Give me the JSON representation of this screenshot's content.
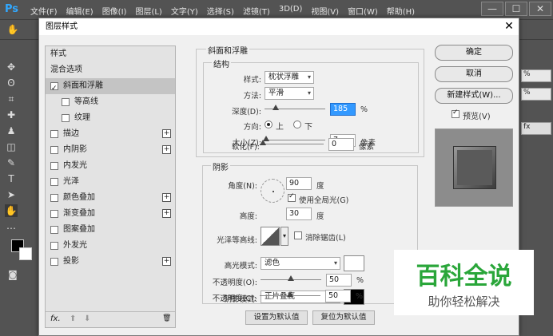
{
  "app": {
    "logo": "Ps",
    "menus": [
      "文件(F)",
      "编辑(E)",
      "图像(I)",
      "图层(L)",
      "文字(Y)",
      "选择(S)",
      "滤镜(T)",
      "3D(D)",
      "视图(V)",
      "窗口(W)",
      "帮助(H)"
    ],
    "window_controls": [
      "—",
      "☐",
      "✕"
    ]
  },
  "right_panel": {
    "items": [
      "%",
      "%",
      "fx"
    ]
  },
  "dialog": {
    "title": "图层样式",
    "close_glyph": "✕",
    "styles_list": {
      "header": "样式",
      "items": [
        {
          "label": "混合选项",
          "checkbox": false,
          "checked": false,
          "plus": false,
          "indent": false,
          "selected": false
        },
        {
          "label": "斜面和浮雕",
          "checkbox": true,
          "checked": true,
          "plus": false,
          "indent": false,
          "selected": true
        },
        {
          "label": "等高线",
          "checkbox": true,
          "checked": false,
          "plus": false,
          "indent": true,
          "selected": false
        },
        {
          "label": "纹理",
          "checkbox": true,
          "checked": false,
          "plus": false,
          "indent": true,
          "selected": false
        },
        {
          "label": "描边",
          "checkbox": true,
          "checked": false,
          "plus": true,
          "indent": false,
          "selected": false
        },
        {
          "label": "内阴影",
          "checkbox": true,
          "checked": false,
          "plus": true,
          "indent": false,
          "selected": false
        },
        {
          "label": "内发光",
          "checkbox": true,
          "checked": false,
          "plus": false,
          "indent": false,
          "selected": false
        },
        {
          "label": "光泽",
          "checkbox": true,
          "checked": false,
          "plus": false,
          "indent": false,
          "selected": false
        },
        {
          "label": "颜色叠加",
          "checkbox": true,
          "checked": false,
          "plus": true,
          "indent": false,
          "selected": false
        },
        {
          "label": "渐变叠加",
          "checkbox": true,
          "checked": false,
          "plus": true,
          "indent": false,
          "selected": false
        },
        {
          "label": "图案叠加",
          "checkbox": true,
          "checked": false,
          "plus": false,
          "indent": false,
          "selected": false
        },
        {
          "label": "外发光",
          "checkbox": true,
          "checked": false,
          "plus": false,
          "indent": false,
          "selected": false
        },
        {
          "label": "投影",
          "checkbox": true,
          "checked": false,
          "plus": true,
          "indent": false,
          "selected": false
        }
      ],
      "footer_fx": "fx.",
      "footer_up": "⬆",
      "footer_down": "⬇",
      "footer_trash": "🗑"
    },
    "bevel": {
      "section_title": "斜面和浮雕",
      "structure_title": "结构",
      "style_label": "样式:",
      "style_value": "枕状浮雕",
      "technique_label": "方法:",
      "technique_value": "平滑",
      "depth_label": "深度(D):",
      "depth_value": "185",
      "depth_unit": "%",
      "depth_level": 0.18,
      "direction_label": "方向:",
      "direction_up": "上",
      "direction_down": "下",
      "size_label": "大小(Z):",
      "size_value": "7",
      "size_unit": "像素",
      "size_level": 0.03,
      "soften_label": "软化(F):",
      "soften_value": "0",
      "soften_unit": "像素",
      "soften_level": 0.0
    },
    "shading": {
      "title": "阴影",
      "angle_label": "角度(N):",
      "angle_value": "90",
      "angle_unit": "度",
      "global_light_label": "使用全局光(G)",
      "altitude_label": "高度:",
      "altitude_value": "30",
      "altitude_unit": "度",
      "gloss_label": "光泽等高线:",
      "antialias_label": "消除锯齿(L)",
      "highlight_mode_label": "高光模式:",
      "highlight_mode_value": "滤色",
      "highlight_color": "#ffffff",
      "highlight_opacity_label": "不透明度(O):",
      "highlight_opacity_value": "50",
      "highlight_opacity_unit": "%",
      "highlight_opacity_level": 0.5,
      "shadow_mode_label": "阴影模式:",
      "shadow_mode_value": "正片叠底",
      "shadow_color": "#000000",
      "shadow_opacity_label": "不透明度(C):",
      "shadow_opacity_value": "50",
      "shadow_opacity_unit": "%",
      "shadow_opacity_level": 0.5
    },
    "make_default": "设置为默认值",
    "reset_default": "复位为默认值",
    "buttons": {
      "ok": "确定",
      "cancel": "取消",
      "new_style": "新建样式(W)...",
      "preview_label": "预览(V)"
    }
  },
  "watermark": {
    "big": "百科全说",
    "small": "助你轻松解决"
  }
}
